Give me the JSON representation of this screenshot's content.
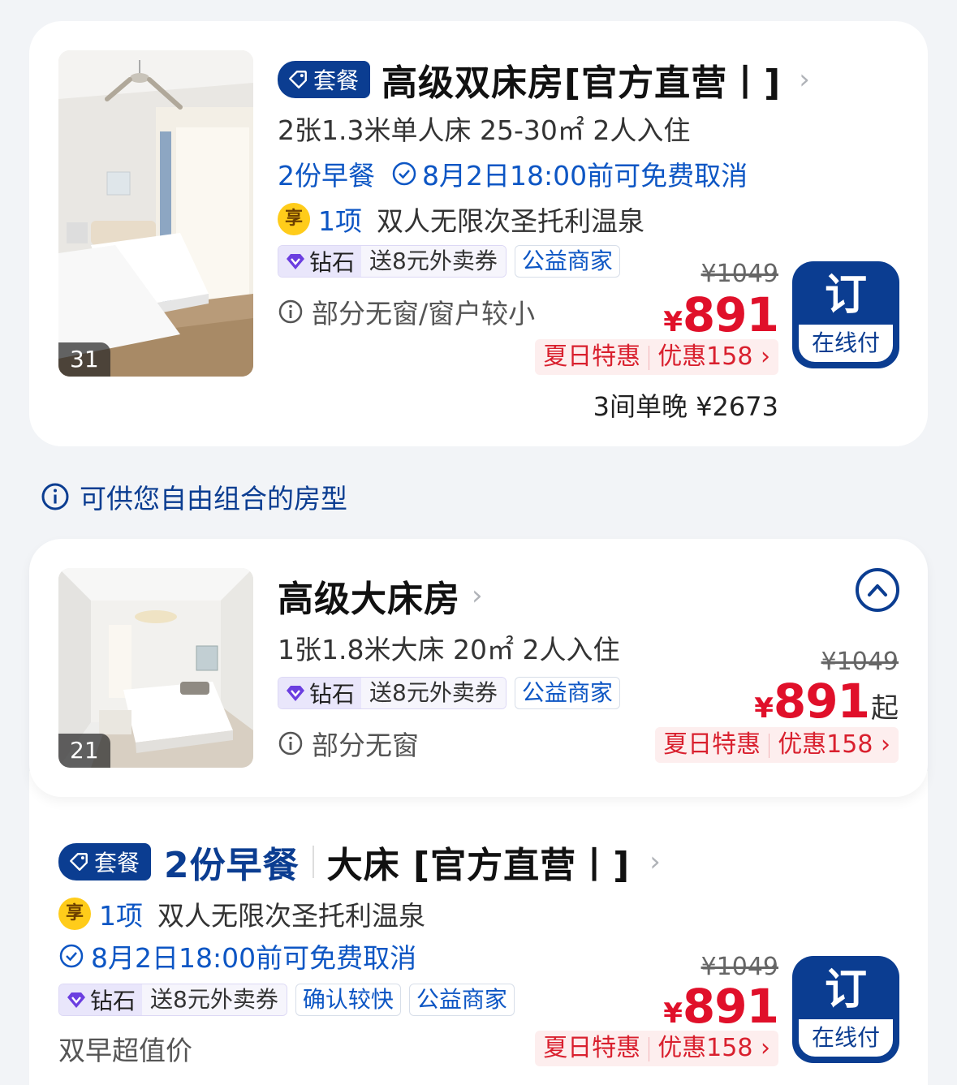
{
  "package_tag": "套餐",
  "card1": {
    "photo_count": "31",
    "title": "高级双床房[官方直营丨]",
    "bed_info": "2张1.3米单人床  25-30㎡  2人入住",
    "breakfast": "2份早餐",
    "cancel": "8月2日18:00前可免费取消",
    "enjoy_icon": "享",
    "enjoy_count": "1项",
    "enjoy_text": "双人无限次圣托利温泉",
    "diamond_label": "钻石",
    "diamond_benefit": "送8元外卖券",
    "charity_tag": "公益商家",
    "window_note": "部分无窗/窗户较小",
    "original_price": "¥1049",
    "price_symbol": "¥",
    "price": "891",
    "promo_label": "夏日特惠",
    "promo_discount": "优惠158",
    "total": "3间单晚 ¥2673",
    "book_label": "订",
    "book_sub": "在线付"
  },
  "notice": {
    "text": "可供您自由组合的房型"
  },
  "card2": {
    "photo_count": "21",
    "title": "高级大床房",
    "bed_info": "1张1.8米大床  20㎡  2人入住",
    "diamond_label": "钻石",
    "diamond_benefit": "送8元外卖券",
    "charity_tag": "公益商家",
    "window_note": "部分无窗",
    "original_price": "¥1049",
    "price_symbol": "¥",
    "price": "891",
    "price_suffix": "起",
    "promo_label": "夏日特惠",
    "promo_discount": "优惠158"
  },
  "card3": {
    "breakfast": "2份早餐",
    "bed": "大床 [官方直营丨]",
    "enjoy_icon": "享",
    "enjoy_count": "1项",
    "enjoy_text": "双人无限次圣托利温泉",
    "cancel": "8月2日18:00前可免费取消",
    "diamond_label": "钻石",
    "diamond_benefit": "送8元外卖券",
    "confirm_tag": "确认较快",
    "charity_tag": "公益商家",
    "value_note": "双早超值价",
    "original_price": "¥1049",
    "price_symbol": "¥",
    "price": "891",
    "promo_label": "夏日特惠",
    "promo_discount": "优惠158",
    "book_label": "订",
    "book_sub": "在线付"
  },
  "colors": {
    "brand_blue": "#0b3d91",
    "link_blue": "#0d56c4",
    "price_red": "#e0102a",
    "promo_bg": "#fdeeee",
    "enjoy_yellow": "#ffcc1a"
  }
}
